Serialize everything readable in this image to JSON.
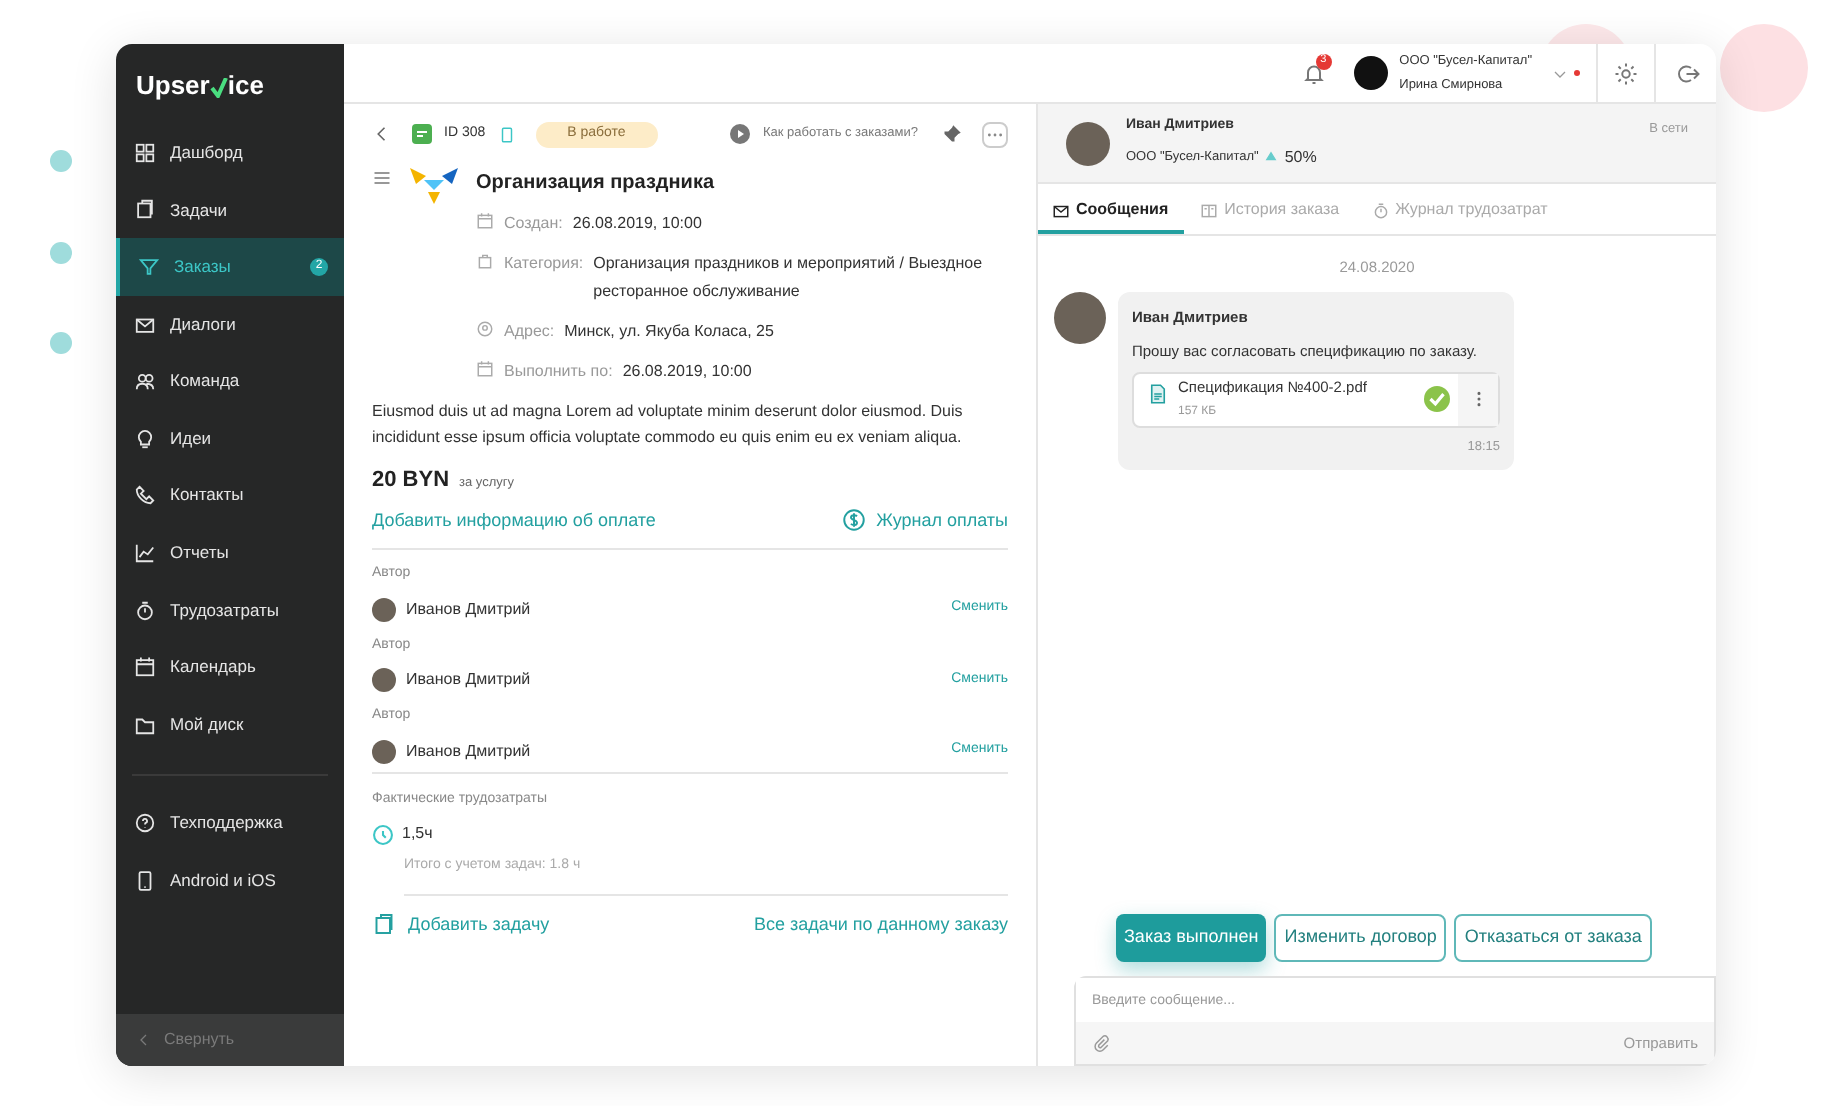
{
  "sidebar": {
    "logo": {
      "before": "Upser",
      "after": "ice"
    },
    "items": [
      {
        "label": "Дашборд",
        "selected": false
      },
      {
        "label": "Задачи",
        "selected": false
      },
      {
        "label": "Заказы",
        "selected": true,
        "badge": "2"
      },
      {
        "label": "Диалоги",
        "selected": false
      },
      {
        "label": "Команда",
        "selected": false
      },
      {
        "label": "Идеи",
        "selected": false
      },
      {
        "label": "Контакты",
        "selected": false
      },
      {
        "label": "Отчеты",
        "selected": false
      },
      {
        "label": "Трудозатраты",
        "selected": false
      },
      {
        "label": "Календарь",
        "selected": false
      },
      {
        "label": "Мой диск",
        "selected": false
      }
    ],
    "extra_items": [
      {
        "label": "Техподдержка"
      },
      {
        "label": "Android и iOS"
      }
    ],
    "collapse": "Свернуть"
  },
  "top_bar": {
    "notifications": "3",
    "company": "ООО \"Бусел-Капитал\"",
    "user": "Ирина Смирнова"
  },
  "order": {
    "id": "ID 308",
    "status": "В работе",
    "help_link": "Как работать с заказами?",
    "title": "Организация праздника",
    "meta": [
      {
        "label": "Создан:",
        "value": "26.08.2019, 10:00"
      },
      {
        "label": "Категория:",
        "value": "Организация праздников и мероприятий / Выездное ресторанное обслуживание"
      },
      {
        "label": "Адрес:",
        "value": "Минск, ул. Якуба Коласа, 25"
      },
      {
        "label": "Выполнить по:",
        "value": "26.08.2019, 10:00"
      }
    ],
    "description": "Eiusmod duis ut ad magna Lorem ad voluptate minim deserunt dolor eiusmod. Duis incididunt esse ipsum officia voluptate commodo eu quis enim eu ex veniam aliqua.",
    "price": "20 BYN",
    "price_note": "за услугу",
    "add_payment": "Добавить информацию об оплате",
    "payment_log": "Журнал оплаты",
    "people": [
      {
        "role": "Автор",
        "name": "Иванов Дмитрий",
        "action": "Сменить"
      },
      {
        "role": "Автор",
        "name": "Иванов Дмитрий",
        "action": "Сменить"
      },
      {
        "role": "Автор",
        "name": "Иванов Дмитрий",
        "action": "Сменить"
      }
    ],
    "labor": {
      "label": "Фактические трудозатраты",
      "value": "1,5ч",
      "total": "Итого с учетом задач: 1.8 ч"
    },
    "add_task": "Добавить задачу",
    "all_tasks": "Все задачи по данному заказу"
  },
  "chat": {
    "contact": {
      "name": "Иван Дмитриев",
      "company": "ООО \"Бусел-Капитал\"",
      "rating": "50%",
      "presence": "В сети"
    },
    "tabs": [
      {
        "label": "Сообщения",
        "selected": true
      },
      {
        "label": "История заказа",
        "selected": false
      },
      {
        "label": "Журнал трудозатрат",
        "selected": false
      }
    ],
    "date": "24.08.2020",
    "message": {
      "author": "Иван Дмитриев",
      "text": "Прошу вас согласовать спецификацию по заказу.",
      "file": {
        "name": "Спецификация №400-2.pdf",
        "size": "157 КБ",
        "approved": true
      },
      "time": "18:15"
    },
    "actions": [
      {
        "label": "Заказ выполнен",
        "primary": true
      },
      {
        "label": "Изменить договор",
        "primary": false
      },
      {
        "label": "Отказаться от заказа",
        "primary": false
      }
    ],
    "input": {
      "placeholder": "Введите сообщение...",
      "send": "Отправить"
    }
  }
}
